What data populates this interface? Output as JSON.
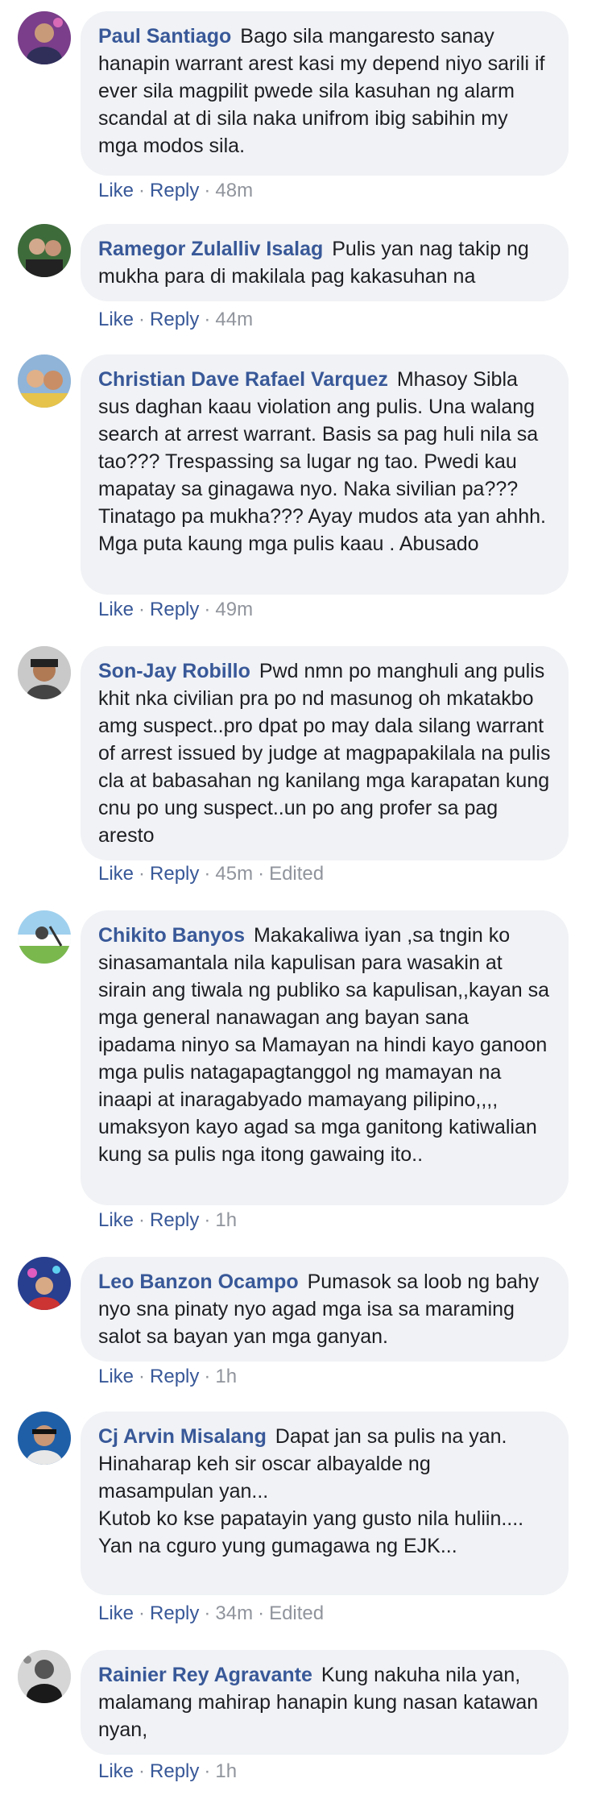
{
  "comments": [
    {
      "author": "Paul Santiago",
      "text": "Bago sila mangaresto sanay hanapin warrant arest kasi my depend niyo sarili if ever sila magpilit pwede sila kasuhan ng alarm scandal at di sila naka unifrom ibig sabihin my mga modos sila.",
      "like": "Like",
      "reply": "Reply",
      "time": "48m",
      "edited": ""
    },
    {
      "author": "Ramegor Zulalliv Isalag",
      "text": "Pulis yan nag takip ng mukha para di makilala pag kakasuhan na",
      "like": "Like",
      "reply": "Reply",
      "time": "44m",
      "edited": ""
    },
    {
      "author": "Christian Dave Rafael Varquez",
      "text": "Mhasoy Sibla sus daghan kaau violation ang pulis. Una walang search at arrest warrant. Basis sa pag huli nila sa tao??? Trespassing sa lugar ng tao. Pwedi kau mapatay sa ginagawa nyo. Naka sivilian pa??? Tinatago pa mukha??? Ayay mudos ata yan ahhh. Mga puta kaung mga pulis kaau . Abusado",
      "like": "Like",
      "reply": "Reply",
      "time": "49m",
      "edited": ""
    },
    {
      "author": "Son-Jay Robillo",
      "text": "Pwd nmn po manghuli ang pulis khit nka civilian pra po nd masunog oh mkatakbo amg suspect..pro dpat po may dala silang warrant of arrest issued by judge at magpapakilala na pulis cla at babasahan ng kanilang mga karapatan kung cnu po ung suspect..un po ang profer sa pag aresto",
      "like": "Like",
      "reply": "Reply",
      "time": "45m",
      "edited": "Edited"
    },
    {
      "author": "Chikito Banyos",
      "text": "Makakaliwa iyan ,sa tngin ko sinasamantala nila kapulisan para wasakin at sirain ang tiwala ng publiko sa kapulisan,,kayan sa mga general nanawagan ang bayan sana ipadama ninyo sa Mamayan na hindi kayo ganoon mga pulis natagapagtanggol ng mamayan na inaapi at inaragabyado mamayang pilipino,,,, umaksyon kayo agad sa mga ganitong katiwalian kung sa pulis nga itong gawaing ito..",
      "like": "Like",
      "reply": "Reply",
      "time": "1h",
      "edited": ""
    },
    {
      "author": "Leo Banzon Ocampo",
      "text": "Pumasok sa loob ng bahy nyo sna pinaty nyo agad mga isa sa maraming salot sa bayan yan mga ganyan.",
      "like": "Like",
      "reply": "Reply",
      "time": "1h",
      "edited": ""
    },
    {
      "author": "Cj Arvin Misalang",
      "text": "Dapat jan sa pulis na yan. Hinaharap keh sir oscar albayalde ng masampulan yan...\nKutob ko kse papatayin yang gusto nila huliin.... Yan na cguro yung gumagawa ng EJK...",
      "like": "Like",
      "reply": "Reply",
      "time": "34m",
      "edited": "Edited"
    },
    {
      "author": "Rainier Rey Agravante",
      "text": "Kung nakuha nila yan, malamang mahirap hanapin kung nasan katawan nyan,",
      "like": "Like",
      "reply": "Reply",
      "time": "1h",
      "edited": ""
    }
  ]
}
